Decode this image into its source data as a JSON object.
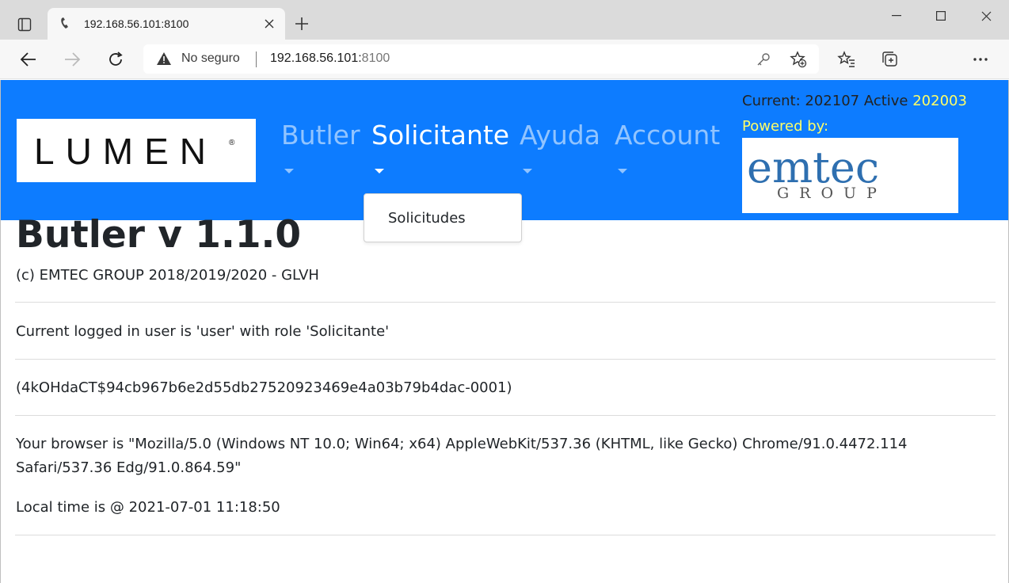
{
  "browser": {
    "tab_title": "192.168.56.101:8100",
    "security_label": "No seguro",
    "url_host": "192.168.56.101:",
    "url_port": "8100"
  },
  "navbar": {
    "brand_name": "LUMEN",
    "brand_mark": "®",
    "items": [
      {
        "label": "Butler"
      },
      {
        "label": "Solicitante"
      },
      {
        "label": "Ayuda"
      },
      {
        "label": "Account"
      }
    ],
    "status_prefix": "Current: 202107 Active ",
    "status_active": "202003",
    "powered_by": "Powered by:",
    "partner_logo": {
      "word": "emtec",
      "sub": "GROUP"
    },
    "colors": {
      "navbar_bg": "#0d7cff",
      "highlight": "#ffff66"
    }
  },
  "dropdown": {
    "items": [
      {
        "label": "Solicitudes"
      }
    ]
  },
  "main": {
    "title": "Butler v 1.1.0",
    "copyright": "(c) EMTEC GROUP 2018/2019/2020 - GLVH",
    "user_info": "Current logged in user is 'user' with role 'Solicitante'",
    "session_id": "(4kOHdaCT$94cb967b6e2d55db27520923469e4a03b79b4dac-0001)",
    "browser_info": "Your browser is \"Mozilla/5.0 (Windows NT 10.0; Win64; x64) AppleWebKit/537.36 (KHTML, like Gecko) Chrome/91.0.4472.114 Safari/537.36 Edg/91.0.864.59\"",
    "local_time": "Local time is @ 2021-07-01 11:18:50"
  }
}
